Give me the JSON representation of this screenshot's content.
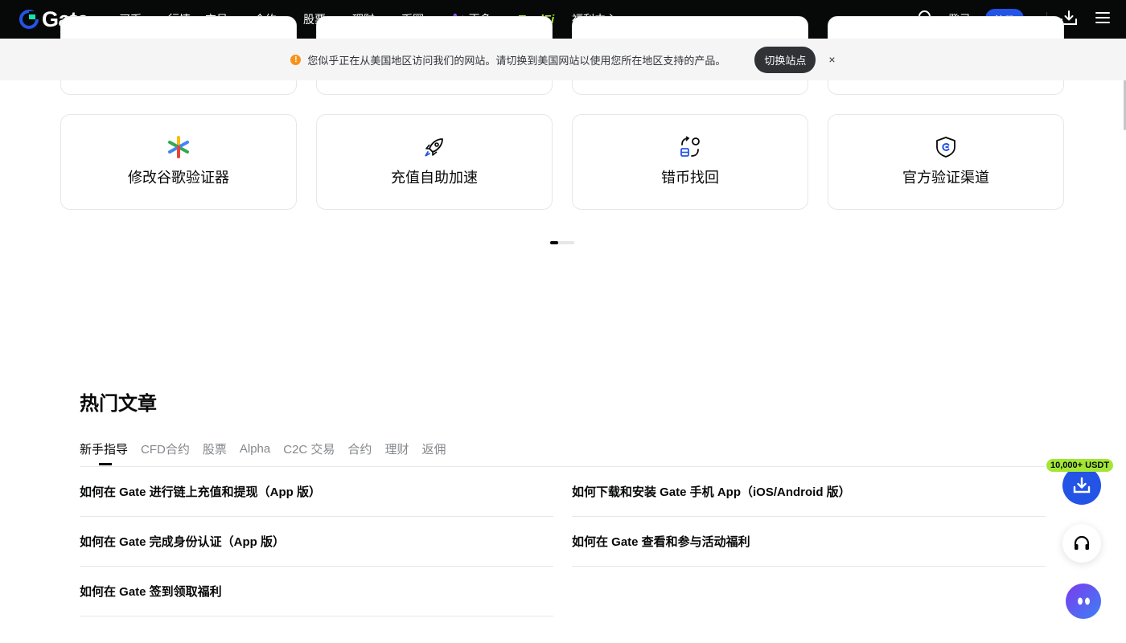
{
  "nav": {
    "logo_text": "Gate",
    "items": [
      {
        "label": "买币",
        "caret": true
      },
      {
        "label": "行情",
        "caret": false
      },
      {
        "label": "交易",
        "caret": true
      },
      {
        "label": "合约",
        "caret": true
      },
      {
        "label": "股票",
        "caret": true
      },
      {
        "label": "理财",
        "caret": true
      },
      {
        "label": "币圈",
        "caret": true
      }
    ],
    "more_label": "更多",
    "tradfi_label": "TradFi",
    "welfare_label": "福利中心",
    "login_label": "登录",
    "signup_label": "注册",
    "icons": [
      "search-icon",
      "download-icon",
      "menu-icon"
    ]
  },
  "banner": {
    "text": "您似乎正在从美国地区访问我们的网站。请切换到美国网站以使用您所在地区支持的产品。",
    "switch_label": "切换站点",
    "close_label": "×"
  },
  "cards": [
    {
      "label": "修改谷歌验证器",
      "icon": "google-authenticator-icon"
    },
    {
      "label": "充值自助加速",
      "icon": "rocket-icon"
    },
    {
      "label": "错币找回",
      "icon": "recover-icon"
    },
    {
      "label": "官方验证渠道",
      "icon": "shield-icon"
    }
  ],
  "pager": {
    "pages": 3,
    "active": 1
  },
  "articles_section": {
    "title": "热门文章",
    "tabs": [
      "新手指导",
      "CFD合约",
      "股票",
      "Alpha",
      "C2C 交易",
      "合约",
      "理财",
      "返佣"
    ],
    "active_tab": 0,
    "articles_left": [
      "如何在 Gate 进行链上充值和提现（App 版）",
      "如何在 Gate 完成身份认证（App 版）",
      "如何在 Gate 签到领取福利"
    ],
    "articles_right": [
      "如何下载和安装 Gate 手机 App（iOS/Android 版）",
      "如何在 Gate 查看和参与活动福利"
    ]
  },
  "floating": {
    "promo_badge": "10,000+ USDT",
    "buttons": [
      "download-icon",
      "headset-icon",
      "chatbot-icon"
    ]
  },
  "colors": {
    "nav_bg": "#070808",
    "brand_blue": "#2354e6",
    "promo_green": "#a3e635",
    "warning_orange": "#f7931a"
  }
}
